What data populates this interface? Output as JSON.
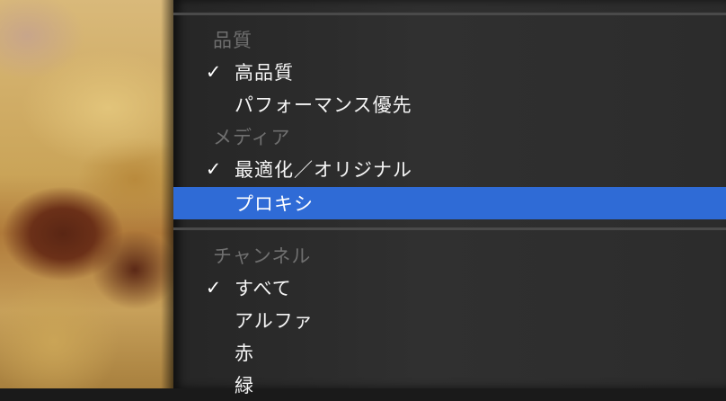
{
  "menu": {
    "sections": [
      {
        "header": "品質",
        "items": [
          {
            "label": "高品質",
            "checked": true
          },
          {
            "label": "パフォーマンス優先",
            "checked": false
          }
        ]
      },
      {
        "header": "メディア",
        "items": [
          {
            "label": "最適化／オリジナル",
            "checked": true
          },
          {
            "label": "プロキシ",
            "checked": false,
            "highlighted": true
          }
        ]
      },
      {
        "header": "チャンネル",
        "items": [
          {
            "label": "すべて",
            "checked": true
          },
          {
            "label": "アルファ",
            "checked": false
          },
          {
            "label": "赤",
            "checked": false
          },
          {
            "label": "緑",
            "checked": false
          }
        ]
      }
    ],
    "checkmark": "✓",
    "highlight_color": "#2f6bd6"
  }
}
